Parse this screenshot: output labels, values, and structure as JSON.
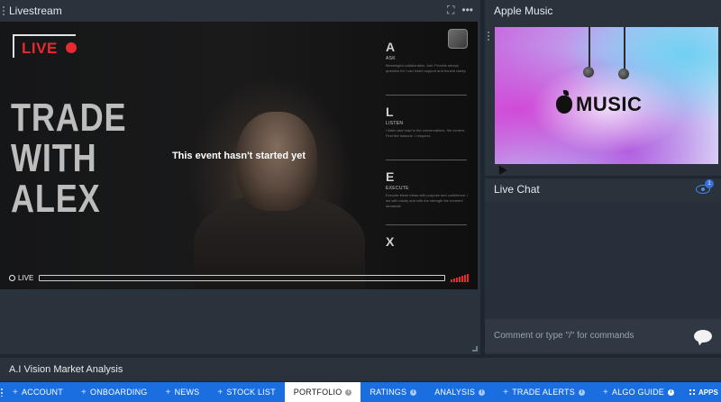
{
  "livestream": {
    "title": "Livestream",
    "expand_icon": "expand-icon",
    "more_icon": "more-icon",
    "video": {
      "live_logo_text": "LIVE",
      "show_title_lines": [
        "TRADE",
        "WITH",
        "ALEX"
      ],
      "status_message": "This event hasn't started yet",
      "side_items": [
        {
          "letter": "A",
          "word": "ASK",
          "text": "Meaningful collaboration. Ask: Provide steady question for I can insert support and honest clarity."
        },
        {
          "letter": "L",
          "word": "LISTEN",
          "text": "I listen and read to the conversations, the context. Find the reasons. I respond."
        },
        {
          "letter": "E",
          "word": "EXECUTE",
          "text": "Execute these ideas with purpose and confidence. I act with clarity and with the strength the moment demands."
        },
        {
          "letter": "X",
          "word": "",
          "text": ""
        }
      ],
      "live_label": "LIVE"
    }
  },
  "apple_music": {
    "title": "Apple Music",
    "logo_text": "MUSIC"
  },
  "live_chat": {
    "title": "Live Chat",
    "viewer_count": "1",
    "input_placeholder": "Comment or type \"/\" for commands"
  },
  "analysis": {
    "title": "A.I Vision Market Analysis"
  },
  "tabs": [
    {
      "label": "ACCOUNT",
      "plus": true,
      "info": false,
      "active": false
    },
    {
      "label": "ONBOARDING",
      "plus": true,
      "info": false,
      "active": false
    },
    {
      "label": "NEWS",
      "plus": true,
      "info": false,
      "active": false
    },
    {
      "label": "STOCK LIST",
      "plus": true,
      "info": false,
      "active": false
    },
    {
      "label": "PORTFOLIO",
      "plus": false,
      "info": true,
      "active": true
    },
    {
      "label": "RATINGS",
      "plus": false,
      "info": true,
      "active": false
    },
    {
      "label": "ANALYSIS",
      "plus": false,
      "info": true,
      "active": false
    },
    {
      "label": "TRADE ALERTS",
      "plus": true,
      "info": true,
      "active": false
    },
    {
      "label": "ALGO GUIDE",
      "plus": true,
      "info": true,
      "active": false
    }
  ],
  "apps_label": "APPS",
  "colors": {
    "panel_bg": "#2a323b",
    "tabbar_blue": "#1a6ee0",
    "live_red": "#e8292d"
  }
}
